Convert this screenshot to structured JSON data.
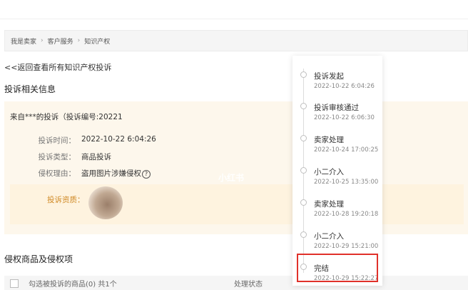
{
  "breadcrumb": [
    "我是卖家",
    "客户服务",
    "知识产权"
  ],
  "back_link": "<<返回查看所有知识产权投诉",
  "section_info_title": "投诉相关信息",
  "complaint": {
    "header": "来自***的投诉（投诉编号:20221",
    "rows": [
      {
        "key": "投诉时间：",
        "value": "2022-10-22 6:04:26"
      },
      {
        "key": "投诉类型：",
        "value": "商品投诉"
      },
      {
        "key": "侵权理由：",
        "value": "盗用图片涉嫌侵权"
      }
    ],
    "qualification_label": "投诉资质："
  },
  "watermark": "小红书",
  "section_goods_title": "侵权商品及侵权项",
  "table": {
    "col_select": "勾选被投诉的商品(0) 共1个",
    "col_status": "处理状态"
  },
  "timeline": [
    {
      "title": "投诉发起",
      "time": "2022-10-22 6:04:26"
    },
    {
      "title": "投诉审核通过",
      "time": "2022-10-22 6:06:30"
    },
    {
      "title": "卖家处理",
      "time": "2022-10-24 17:00:25"
    },
    {
      "title": "小二介入",
      "time": "2022-10-25 13:35:00"
    },
    {
      "title": "卖家处理",
      "time": "2022-10-28 19:20:18"
    },
    {
      "title": "小二介入",
      "time": "2022-10-29 15:21:00"
    },
    {
      "title": "完结",
      "time": "2022-10-29 15:22:27"
    }
  ],
  "colors": {
    "highlight": "#e0312a",
    "qualification": "#d08a26",
    "panel": "#fdf7ec"
  }
}
